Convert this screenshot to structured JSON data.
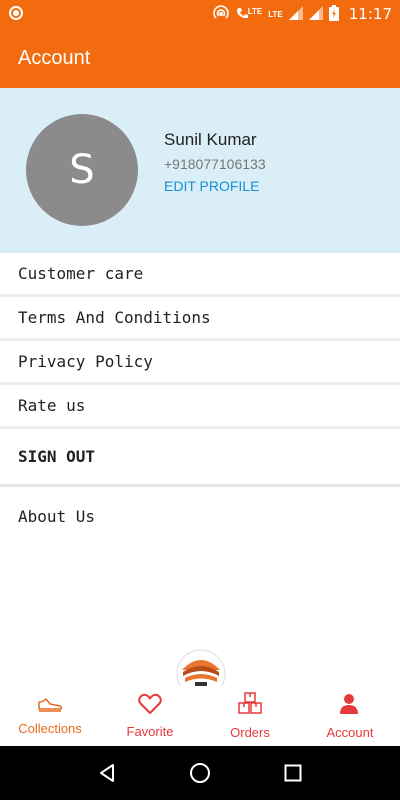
{
  "status_bar": {
    "time": "11:17",
    "network_label_1": "LTE",
    "network_label_2": "LTE"
  },
  "app_bar": {
    "title": "Account"
  },
  "profile": {
    "avatar_initial": "S",
    "name": "Sunil Kumar",
    "phone": "+918077106133",
    "edit_label": "EDIT PROFILE"
  },
  "menu": {
    "items": [
      {
        "label": "Customer care"
      },
      {
        "label": "Terms And Conditions"
      },
      {
        "label": "Privacy Policy"
      },
      {
        "label": "Rate us"
      },
      {
        "label": "SIGN OUT"
      },
      {
        "label": "About Us"
      }
    ]
  },
  "bottom_nav": {
    "items": [
      {
        "label": "Collections",
        "icon": "shoe-icon"
      },
      {
        "label": "Favorite",
        "icon": "heart-icon"
      },
      {
        "label": "Orders",
        "icon": "boxes-icon"
      },
      {
        "label": "Account",
        "icon": "user-icon",
        "active": true
      }
    ]
  },
  "colors": {
    "primary": "#f26b0f",
    "profile_bg": "#d9eef7",
    "link": "#1a8fd6",
    "nav_red": "#e53a3a"
  }
}
